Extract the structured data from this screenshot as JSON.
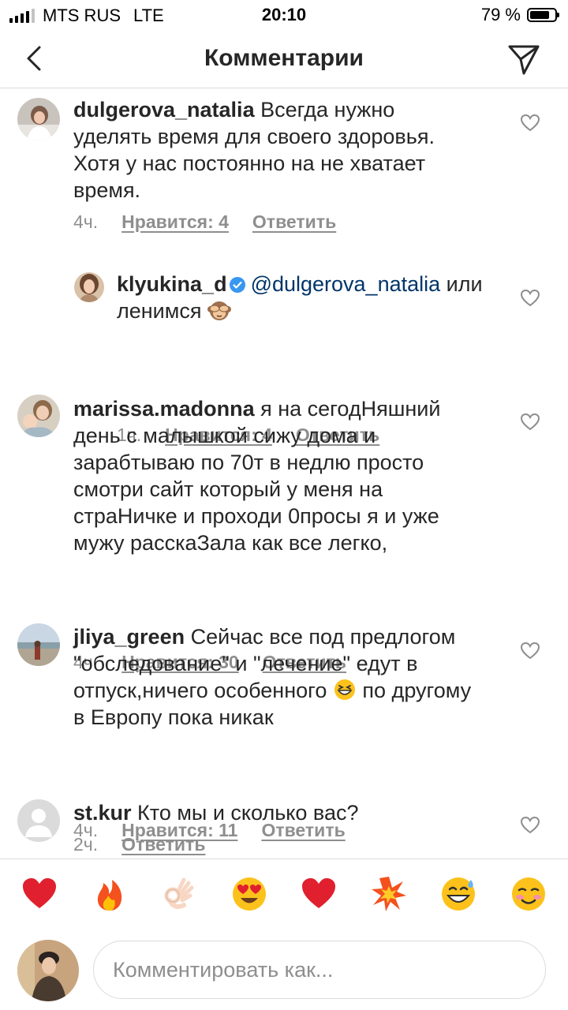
{
  "status_bar": {
    "carrier": "MTS RUS",
    "network": "LTE",
    "time": "20:10",
    "battery": "79 %",
    "battery_level": 0.79
  },
  "header": {
    "title": "Комментарии",
    "back_icon": "chevron-left-icon",
    "send_icon": "paper-plane-icon"
  },
  "comments": [
    {
      "username": "dulgerova_natalia",
      "text": "Всегда нужно уделять время для своего здоровья. Хотя у нас постоянно на не хватает время.",
      "time": "4ч.",
      "likes": "Нравится: 4",
      "reply": "Ответить"
    },
    {
      "username": "klyukina_d",
      "verified": true,
      "mention": "@dulgerova_natalia",
      "text": "или ленимся",
      "emoji": "see-no-evil-monkey",
      "time": "1ч.",
      "likes": "Нравится: 4",
      "reply": "Ответить"
    },
    {
      "username": "marissa.madonna",
      "text": "я на сегодНяшний день с малышкой сижу дома и зарабтываю по 70т в недлю просто смотри сайт который у меня на страНичке и проходи 0просы я и уже мужу расскаЗала как все легко,",
      "time": "4ч.",
      "likes": "Нравится: 30",
      "reply": "Ответить"
    },
    {
      "username": "jliya_green",
      "text_a": "Сейчас все под предлогом \"обследование\" и \"лечение\" едут в отпуск,ничего особенного",
      "emoji": "grinning-squinting-face",
      "text_b": "по другому в Европу пока никак",
      "time": "4ч.",
      "likes": "Нравится: 11",
      "reply": "Ответить"
    },
    {
      "username": "st.kur",
      "text": "Кто мы и сколько вас?",
      "time": "2ч.",
      "reply": "Ответить"
    }
  ],
  "emoji_bar": [
    "red-heart",
    "fire",
    "ok-hand",
    "heart-eyes",
    "red-heart",
    "collision",
    "grinning-sweat",
    "smiling-face"
  ],
  "composer": {
    "placeholder": "Комментировать как..."
  },
  "colors": {
    "text": "#262626",
    "secondary": "#8e8e8e",
    "mention": "#003569",
    "verified": "#3897f0",
    "divider": "#dbdbdb"
  }
}
